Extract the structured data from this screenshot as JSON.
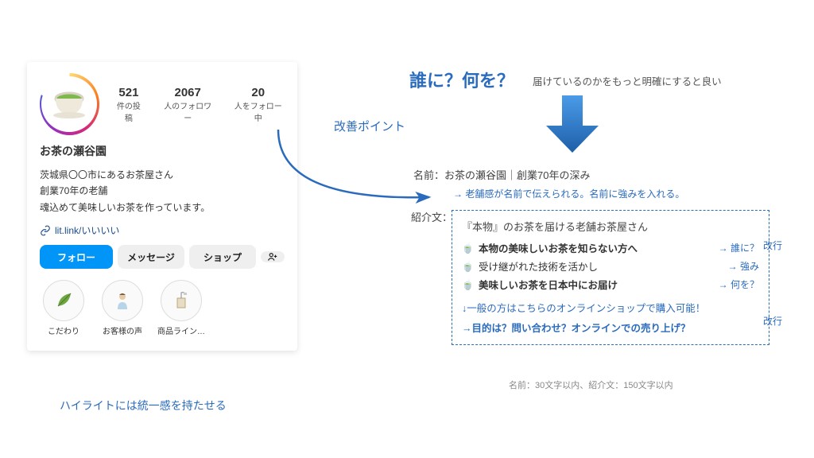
{
  "ig": {
    "name": "お茶の瀬谷園",
    "bio_line1": "茨城県〇〇市にあるお茶屋さん",
    "bio_line2": "創業70年の老舗",
    "bio_line3": "魂込めて美味しいお茶を作っています。",
    "link_text": "lit.link/いいいい",
    "stats": {
      "posts_num": "521",
      "posts_label": "件の投稿",
      "followers_num": "2067",
      "followers_label": "人のフォロワー",
      "following_num": "20",
      "following_label": "人をフォロー中"
    },
    "buttons": {
      "follow": "フォロー",
      "message": "メッセージ",
      "shop": "ショップ"
    },
    "highlights": [
      {
        "label": "こだわり"
      },
      {
        "label": "お客様の声"
      },
      {
        "label": "商品ライン…"
      }
    ]
  },
  "left_caption": "ハイライトには統一感を持たせる",
  "improve_label": "改善ポイント",
  "headline": {
    "a": "誰に？何を？",
    "b": "届けているのかをもっと明確にすると良い"
  },
  "right": {
    "name_line": "名前：お茶の瀬谷園｜創業70年の深み",
    "name_note": "老舗感が名前で伝えられる。名前に強みを入れる。",
    "bio_label": "紹介文：",
    "bio_head": "『本物』のお茶を届ける老舗お茶屋さん",
    "rows": [
      {
        "text": "本物の美味しいお茶を知らない方へ",
        "tag": "→ 誰に？",
        "bold": true
      },
      {
        "text": "受け継がれた技術を活かし",
        "tag": "→ 強み",
        "bold": false
      },
      {
        "text": "美味しいお茶を日本中にお届け",
        "tag": "→ 何を？",
        "bold": true
      }
    ],
    "cta1": "↓一般の方はこちらのオンラインショップで購入可能！",
    "cta2": "→目的は？問い合わせ？オンラインでの売り上げ？",
    "side_note": "改行",
    "footnote": "名前：30文字以内、紹介文：150文字以内"
  }
}
